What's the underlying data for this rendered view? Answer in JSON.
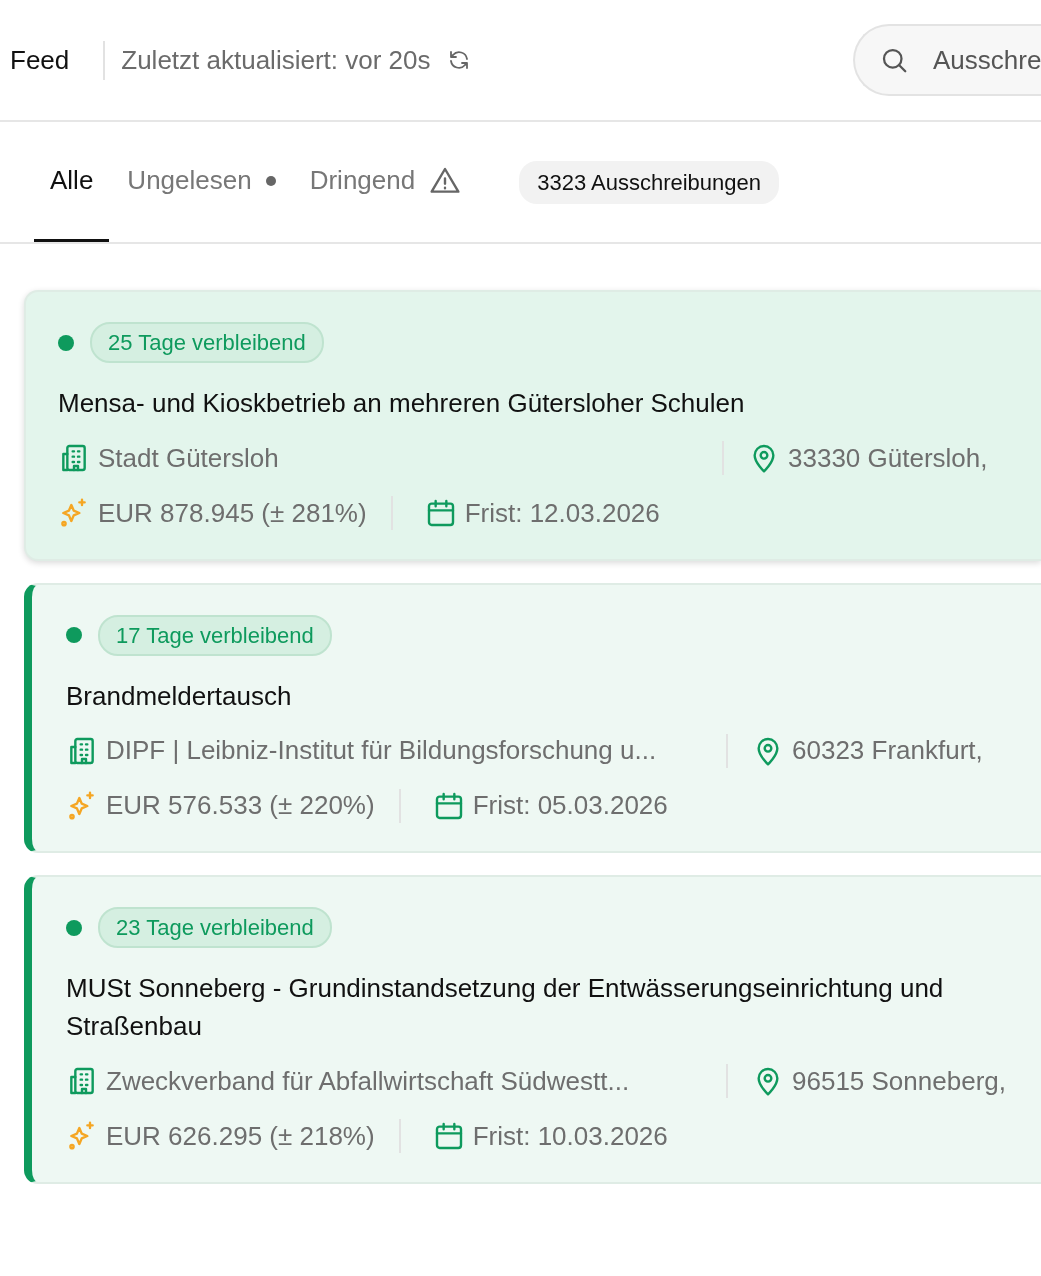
{
  "header": {
    "title": "Feed",
    "updated": "Zuletzt aktualisiert: vor 20s",
    "search": {
      "placeholder": "Ausschre"
    }
  },
  "tabs": [
    {
      "label": "Alle",
      "selected": true,
      "kind": "plain"
    },
    {
      "label": "Ungelesen",
      "selected": false,
      "kind": "dot"
    },
    {
      "label": "Dringend",
      "selected": false,
      "kind": "warning"
    }
  ],
  "count": "3323 Ausschreibungen",
  "tenders": [
    {
      "remaining": "25 Tage verbleibend",
      "title": "Mensa- und Kioskbetrieb an mehreren Gütersloher Schulen",
      "authority": "Stadt Gütersloh",
      "location": "33330 Gütersloh,",
      "value": "EUR 878.945 (± 281%)",
      "deadline": "Frist: 12.03.2026",
      "selected": true,
      "unread": false
    },
    {
      "remaining": "17 Tage verbleibend",
      "title": "Brandmeldertausch",
      "authority": "DIPF | Leibniz-Institut für Bildungsforschung u...",
      "location": "60323 Frankfurt,",
      "value": "EUR 576.533 (± 220%)",
      "deadline": "Frist: 05.03.2026",
      "selected": false,
      "unread": true
    },
    {
      "remaining": "23 Tage verbleibend",
      "title": "MUSt Sonneberg - Grundinstandsetzung der Entwässerungseinrichtung und Straßenbau",
      "authority": "Zweckverband für Abfallwirtschaft Südwestt...",
      "location": "96515 Sonneberg,",
      "value": "EUR 626.295 (± 218%)",
      "deadline": "Frist: 10.03.2026",
      "selected": false,
      "unread": true
    }
  ]
}
